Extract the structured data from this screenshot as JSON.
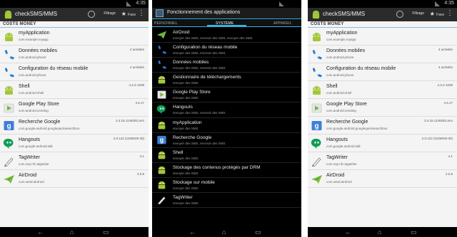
{
  "left": {
    "time": "4:35",
    "app_title": "checkSMS/MMS",
    "filter_label": "Filtrage",
    "favorites_label": "Favs",
    "section_header": "COSTS MONEY",
    "rows": [
      {
        "name": "myApplication",
        "pkg": "com.example.myapp",
        "stat": "",
        "icon": "android-icon"
      },
      {
        "name": "Données mobiles",
        "pkg": "com.android.phone",
        "stat": "4 activités",
        "icon": "phone-icon"
      },
      {
        "name": "Configuration du réseau mobile",
        "pkg": "com.android.phone",
        "stat": "4 activités",
        "icon": "phone-icon"
      },
      {
        "name": "Shell",
        "pkg": "com.android.shell",
        "stat": "4.4.2-1039",
        "icon": "android-icon"
      },
      {
        "name": "Google Play Store",
        "pkg": "com.android.vending",
        "stat": "4.6.17",
        "icon": "play-store-icon"
      },
      {
        "name": "Recherche Google",
        "pkg": "com.google.android.googlequicksearchbox",
        "stat": "3.4.16.1149292.arm",
        "icon": "google-search-icon"
      },
      {
        "name": "Hangouts",
        "pkg": "com.google.android.talk",
        "stat": "2.0.122 (1028028-30)",
        "icon": "hangouts-icon"
      },
      {
        "name": "TagWriter",
        "pkg": "com.nxp.nfc.tagwriter",
        "stat": "4.1",
        "icon": "tagwriter-icon"
      },
      {
        "name": "AirDroid",
        "pkg": "com.sand.airdroid",
        "stat": "2.0.5",
        "icon": "airdroid-icon"
      }
    ]
  },
  "middle": {
    "app_title": "Fonctionnement des applications",
    "tabs": [
      "PERSONNEL",
      "SYSTÈME",
      "APPAREIL"
    ],
    "rows": [
      {
        "name": "AirDroid",
        "perm": "envoyer des SMS, recevoir des SMS, envoyer des SMS",
        "icon": "airdroid-icon"
      },
      {
        "name": "Configuration du réseau mobile",
        "perm": "envoyer des SMS, recevoir des SMS",
        "icon": "phone-icon"
      },
      {
        "name": "Données mobiles",
        "perm": "envoyer des SMS, recevoir des SMS",
        "icon": "phone-icon"
      },
      {
        "name": "Gestionnaire de téléchargements",
        "perm": "envoyer des SMS",
        "icon": "android-icon"
      },
      {
        "name": "Google Play Store",
        "perm": "envoyer des SMS",
        "icon": "play-store-icon"
      },
      {
        "name": "Hangouts",
        "perm": "envoyer des SMS, recevoir des SMS",
        "icon": "hangouts-icon"
      },
      {
        "name": "myApplication",
        "perm": "envoyer des SMS",
        "icon": "android-icon"
      },
      {
        "name": "Recherche Google",
        "perm": "envoyer des SMS, recevoir des SMS",
        "icon": "google-search-icon"
      },
      {
        "name": "Shell",
        "perm": "envoyer des SMS",
        "icon": "android-icon"
      },
      {
        "name": "Stockage des contenus protégés par DRM",
        "perm": "envoyer des SMS",
        "icon": "android-icon"
      },
      {
        "name": "Stockage sur mobile",
        "perm": "envoyer des SMS",
        "icon": "android-icon"
      },
      {
        "name": "TagWriter",
        "perm": "envoyer des SMS",
        "icon": "tagwriter-icon"
      }
    ]
  },
  "right": {
    "time": "4:35",
    "app_title": "checkSMS/MMS",
    "filter_label": "Filtrage",
    "favorites_label": "Favs",
    "section_header": "COSTS MONEY",
    "rows": [
      {
        "name": "myApplication",
        "pkg": "com.example.myapp",
        "stat": "",
        "icon": "android-icon"
      },
      {
        "name": "Données mobiles",
        "pkg": "com.android.phone",
        "stat": "4 activités",
        "icon": "phone-icon"
      },
      {
        "name": "Configuration du réseau mobile",
        "pkg": "com.android.phone",
        "stat": "4 activités",
        "icon": "phone-icon"
      },
      {
        "name": "Shell",
        "pkg": "com.android.shell",
        "stat": "4.4.2-1039",
        "icon": "android-icon"
      },
      {
        "name": "Google Play Store",
        "pkg": "com.android.vending",
        "stat": "4.6.17",
        "icon": "play-store-icon"
      },
      {
        "name": "Recherche Google",
        "pkg": "com.google.android.googlequicksearchbox",
        "stat": "3.4.16.1149292.arm",
        "icon": "google-search-icon"
      },
      {
        "name": "Hangouts",
        "pkg": "com.google.android.talk",
        "stat": "2.0.122 (1028028-30)",
        "icon": "hangouts-icon"
      },
      {
        "name": "TagWriter",
        "pkg": "com.nxp.nfc.tagwriter",
        "stat": "4.1",
        "icon": "tagwriter-icon"
      },
      {
        "name": "AirDroid",
        "pkg": "com.sand.airdroid",
        "stat": "2.0.5",
        "icon": "airdroid-icon"
      }
    ]
  },
  "nav_glyphs": {
    "back": "←",
    "home": "⌂",
    "recents": "▭"
  },
  "colors": {
    "android_green": "#a4c639",
    "phone_blue": "#2a7fd4",
    "holo_blue": "#33b5e5",
    "hangouts_green": "#0f9d58"
  }
}
